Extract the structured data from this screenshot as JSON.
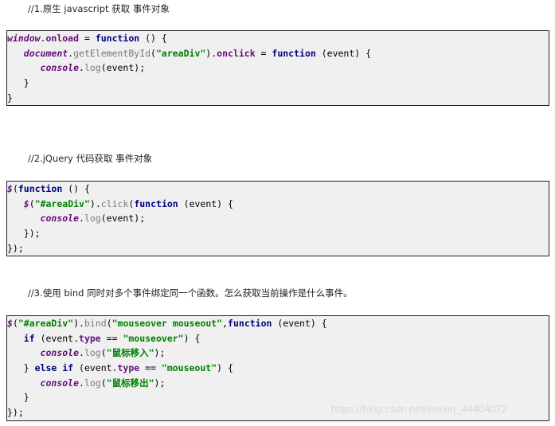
{
  "sections": [
    {
      "heading": "//1.原生 javascript 获取  事件对象",
      "code": [
        [
          [
            "obj",
            "window"
          ],
          [
            "pl",
            "."
          ],
          [
            "prop",
            "onload"
          ],
          [
            "pl",
            " = "
          ],
          [
            "kw",
            "function"
          ],
          [
            "pl",
            " () {"
          ]
        ],
        [
          [
            "pl",
            "   "
          ],
          [
            "obj",
            "document"
          ],
          [
            "pl",
            "."
          ],
          [
            "fn",
            "getElementById"
          ],
          [
            "pl",
            "("
          ],
          [
            "str",
            "\"areaDiv\""
          ],
          [
            "pl",
            ")."
          ],
          [
            "prop",
            "onclick"
          ],
          [
            "pl",
            " = "
          ],
          [
            "kw",
            "function"
          ],
          [
            "pl",
            " (event) {"
          ]
        ],
        [
          [
            "pl",
            "      "
          ],
          [
            "obj",
            "console"
          ],
          [
            "pl",
            "."
          ],
          [
            "fn",
            "log"
          ],
          [
            "pl",
            "(event);"
          ]
        ],
        [
          [
            "pl",
            "   }"
          ]
        ],
        [
          [
            "pl",
            "}"
          ]
        ]
      ]
    },
    {
      "heading": "//2.jQuery 代码获取  事件对象",
      "code": [
        [
          [
            "obj",
            "$"
          ],
          [
            "pl",
            "("
          ],
          [
            "kw",
            "function"
          ],
          [
            "pl",
            " () {"
          ]
        ],
        [
          [
            "pl",
            "   "
          ],
          [
            "obj",
            "$"
          ],
          [
            "pl",
            "("
          ],
          [
            "str",
            "\"#areaDiv\""
          ],
          [
            "pl",
            ")."
          ],
          [
            "fn",
            "click"
          ],
          [
            "pl",
            "("
          ],
          [
            "kw",
            "function"
          ],
          [
            "pl",
            " (event) {"
          ]
        ],
        [
          [
            "pl",
            "      "
          ],
          [
            "obj",
            "console"
          ],
          [
            "pl",
            "."
          ],
          [
            "fn",
            "log"
          ],
          [
            "pl",
            "(event);"
          ]
        ],
        [
          [
            "pl",
            "   });"
          ]
        ],
        [
          [
            "pl",
            "});"
          ]
        ]
      ]
    },
    {
      "heading": "//3.使用 bind 同时对多个事件绑定同一个函数。怎么获取当前操作是什么事件。",
      "code": [
        [
          [
            "obj",
            "$"
          ],
          [
            "pl",
            "("
          ],
          [
            "str",
            "\"#areaDiv\""
          ],
          [
            "pl",
            ")."
          ],
          [
            "fn",
            "bind"
          ],
          [
            "pl",
            "("
          ],
          [
            "str",
            "\"mouseover mouseout\""
          ],
          [
            "pl",
            ","
          ],
          [
            "kw",
            "function"
          ],
          [
            "pl",
            " (event) {"
          ]
        ],
        [
          [
            "pl",
            "   "
          ],
          [
            "kw",
            "if"
          ],
          [
            "pl",
            " (event."
          ],
          [
            "prop",
            "type"
          ],
          [
            "pl",
            " == "
          ],
          [
            "str",
            "\"mouseover\""
          ],
          [
            "pl",
            ") {"
          ]
        ],
        [
          [
            "pl",
            "      "
          ],
          [
            "obj",
            "console"
          ],
          [
            "pl",
            "."
          ],
          [
            "fn",
            "log"
          ],
          [
            "pl",
            "("
          ],
          [
            "str",
            "\"鼠标移入\""
          ],
          [
            "pl",
            ");"
          ]
        ],
        [
          [
            "pl",
            "   } "
          ],
          [
            "kw",
            "else if"
          ],
          [
            "pl",
            " (event."
          ],
          [
            "prop",
            "type"
          ],
          [
            "pl",
            " == "
          ],
          [
            "str",
            "\"mouseout\""
          ],
          [
            "pl",
            ") {"
          ]
        ],
        [
          [
            "pl",
            "      "
          ],
          [
            "obj",
            "console"
          ],
          [
            "pl",
            "."
          ],
          [
            "fn",
            "log"
          ],
          [
            "pl",
            "("
          ],
          [
            "str",
            "\"鼠标移出\""
          ],
          [
            "pl",
            ");"
          ]
        ],
        [
          [
            "pl",
            "   }"
          ]
        ],
        [
          [
            "pl",
            "});"
          ]
        ]
      ]
    }
  ],
  "watermark": "https://blog.csdn.net/weixin_44404072"
}
